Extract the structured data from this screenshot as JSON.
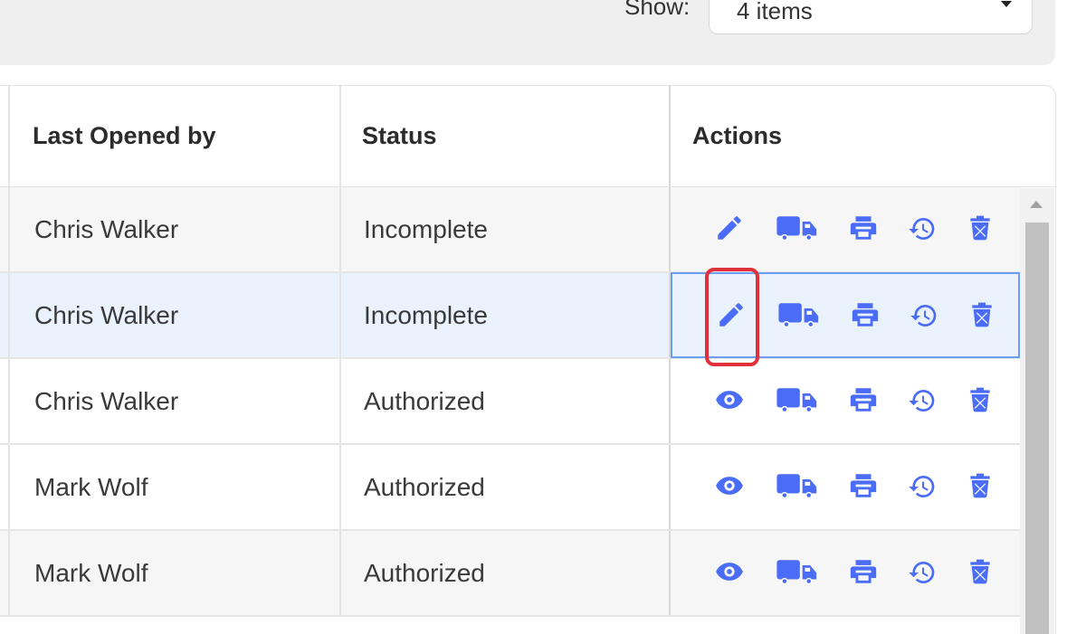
{
  "filter": {
    "show_label": "Show:",
    "show_value": "4 items"
  },
  "table": {
    "columns": [
      "Last Opened by",
      "Status",
      "Actions"
    ],
    "rows": [
      {
        "opened_by": "Chris Walker",
        "status": "Incomplete",
        "first_action": "edit"
      },
      {
        "opened_by": "Chris Walker",
        "status": "Incomplete",
        "first_action": "edit"
      },
      {
        "opened_by": "Chris Walker",
        "status": "Authorized",
        "first_action": "view"
      },
      {
        "opened_by": "Mark Wolf",
        "status": "Authorized",
        "first_action": "view"
      },
      {
        "opened_by": "Mark Wolf",
        "status": "Authorized",
        "first_action": "view"
      }
    ],
    "action_icons": [
      "pencil-icon / eye-icon",
      "truck-icon",
      "printer-icon",
      "history-icon",
      "trash-icon"
    ]
  },
  "colors": {
    "icon": "#4a6cf7",
    "highlight": "#e0303a",
    "selected_row": "#e9f2fd"
  }
}
